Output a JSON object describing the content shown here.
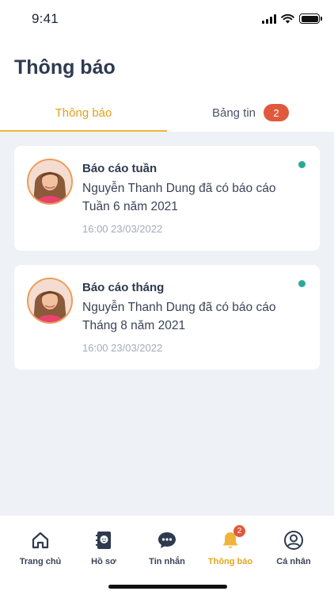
{
  "status_bar": {
    "time": "9:41"
  },
  "header": {
    "title": "Thông báo"
  },
  "tabs": [
    {
      "label": "Thông báo",
      "active": true
    },
    {
      "label": "Bảng tin",
      "badge": "2",
      "active": false
    }
  ],
  "notifications": [
    {
      "title": "Báo cáo tuần",
      "body": "Nguyễn Thanh Dung đã có báo cáo Tuần 6 năm 2021",
      "time": "16:00 23/03/2022",
      "unread": true
    },
    {
      "title": "Báo cáo tháng",
      "body": "Nguyễn Thanh Dung đã có báo cáo Tháng 8 năm 2021",
      "time": "16:00 23/03/2022",
      "unread": true
    }
  ],
  "bottom_nav": [
    {
      "label": "Trang chủ",
      "icon": "home-icon"
    },
    {
      "label": "Hồ sơ",
      "icon": "profile-book-icon"
    },
    {
      "label": "Tin nhắn",
      "icon": "chat-icon"
    },
    {
      "label": "Thông báo",
      "icon": "bell-icon",
      "badge": "2",
      "active": true
    },
    {
      "label": "Cá nhân",
      "icon": "user-circle-icon"
    }
  ],
  "colors": {
    "accent": "#f0b43c",
    "badge": "#e0593c",
    "unread_dot": "#2aa89a",
    "background": "#eef1f6"
  }
}
